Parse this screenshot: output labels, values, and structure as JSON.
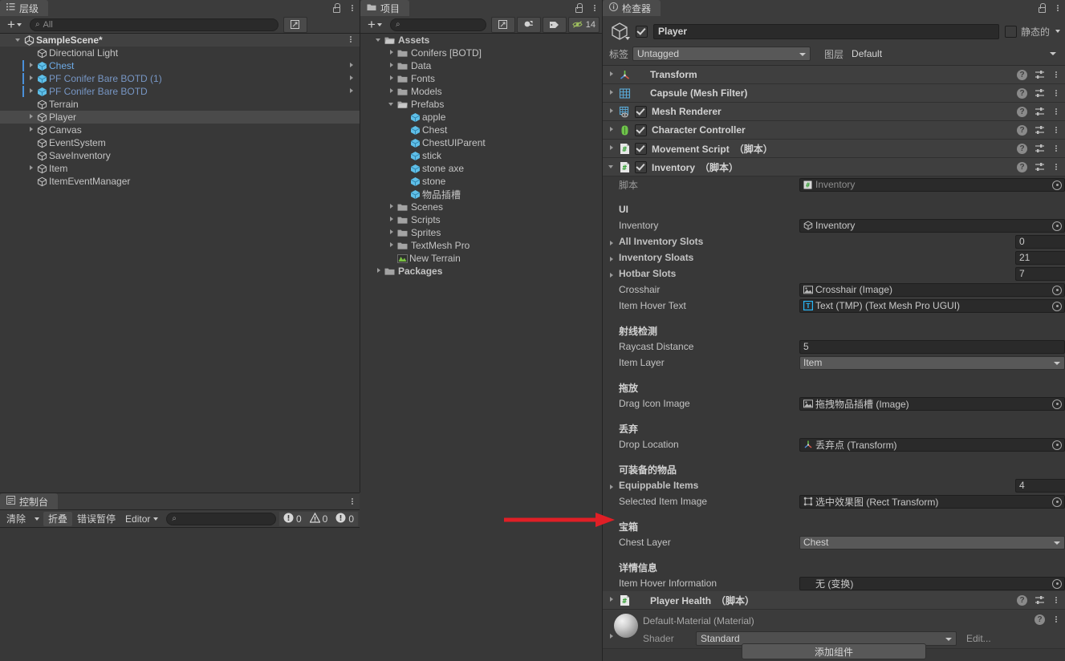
{
  "hierarchy": {
    "tab_label": "层级",
    "tab_icon": "hierarchy-icon",
    "add_label": "+",
    "search_placeholder": "All",
    "items": [
      {
        "name": "SampleScene*",
        "depth": 0,
        "icon": "unity-scene",
        "state": "open",
        "scene": true
      },
      {
        "name": "Directional Light",
        "depth": 1,
        "icon": "gameobject",
        "state": "none"
      },
      {
        "name": "Chest",
        "depth": 1,
        "icon": "prefab",
        "state": "closed",
        "prefab": true,
        "color": "prefab-blue-strong",
        "overflow": true
      },
      {
        "name": "PF Conifer Bare BOTD (1)",
        "depth": 1,
        "icon": "prefab",
        "state": "closed",
        "prefab": true,
        "color": "prefab-blue",
        "overflow": true
      },
      {
        "name": "PF Conifer Bare BOTD",
        "depth": 1,
        "icon": "prefab",
        "state": "closed",
        "prefab": true,
        "color": "prefab-blue",
        "overflow": true
      },
      {
        "name": "Terrain",
        "depth": 1,
        "icon": "gameobject",
        "state": "none"
      },
      {
        "name": "Player",
        "depth": 1,
        "icon": "gameobject",
        "state": "closed",
        "selected": true
      },
      {
        "name": "Canvas",
        "depth": 1,
        "icon": "gameobject",
        "state": "closed"
      },
      {
        "name": "EventSystem",
        "depth": 1,
        "icon": "gameobject",
        "state": "none"
      },
      {
        "name": "SaveInventory",
        "depth": 1,
        "icon": "gameobject",
        "state": "none"
      },
      {
        "name": "Item",
        "depth": 1,
        "icon": "gameobject",
        "state": "closed"
      },
      {
        "name": "ItemEventManager",
        "depth": 1,
        "icon": "gameobject",
        "state": "none"
      }
    ]
  },
  "project": {
    "tab_label": "项目",
    "tab_icon": "folder-icon",
    "add_label": "+",
    "search_placeholder": "",
    "toolbar_buttons": [
      "save-search-icon",
      "packages-icon",
      "label-icon"
    ],
    "hidden_count": "14",
    "items": [
      {
        "name": "Assets",
        "depth": 0,
        "icon": "folder-open",
        "state": "open",
        "bold": true
      },
      {
        "name": "Conifers [BOTD]",
        "depth": 1,
        "icon": "folder",
        "state": "closed"
      },
      {
        "name": "Data",
        "depth": 1,
        "icon": "folder",
        "state": "closed"
      },
      {
        "name": "Fonts",
        "depth": 1,
        "icon": "folder",
        "state": "closed"
      },
      {
        "name": "Models",
        "depth": 1,
        "icon": "folder",
        "state": "closed"
      },
      {
        "name": "Prefabs",
        "depth": 1,
        "icon": "folder-open",
        "state": "open"
      },
      {
        "name": "apple",
        "depth": 2,
        "icon": "prefab",
        "state": "none"
      },
      {
        "name": "Chest",
        "depth": 2,
        "icon": "prefab",
        "state": "none"
      },
      {
        "name": "ChestUIParent",
        "depth": 2,
        "icon": "prefab",
        "state": "none"
      },
      {
        "name": "stick",
        "depth": 2,
        "icon": "prefab",
        "state": "none"
      },
      {
        "name": "stone axe",
        "depth": 2,
        "icon": "prefab",
        "state": "none"
      },
      {
        "name": "stone",
        "depth": 2,
        "icon": "prefab",
        "state": "none"
      },
      {
        "name": "物品插槽",
        "depth": 2,
        "icon": "prefab",
        "state": "none"
      },
      {
        "name": "Scenes",
        "depth": 1,
        "icon": "folder",
        "state": "closed"
      },
      {
        "name": "Scripts",
        "depth": 1,
        "icon": "folder",
        "state": "closed"
      },
      {
        "name": "Sprites",
        "depth": 1,
        "icon": "folder",
        "state": "closed"
      },
      {
        "name": "TextMesh Pro",
        "depth": 1,
        "icon": "folder",
        "state": "closed"
      },
      {
        "name": "New Terrain",
        "depth": 1,
        "icon": "terrain",
        "state": "none"
      },
      {
        "name": "Packages",
        "depth": 0,
        "icon": "folder",
        "state": "closed",
        "bold": true
      }
    ]
  },
  "inspector": {
    "tab_label": "检查器",
    "tab_icon": "info-icon",
    "object_name": "Player",
    "object_enabled": true,
    "static_label": "静态的",
    "static_checked": false,
    "tag_label": "标签",
    "tag_value": "Untagged",
    "layer_label": "图层",
    "layer_value": "Default",
    "components": [
      {
        "title": "Transform",
        "icon": "transform-icon",
        "state": "closed",
        "has_checkbox": false
      },
      {
        "title": "Capsule (Mesh Filter)",
        "icon": "mesh-filter-icon",
        "state": "closed",
        "has_checkbox": false
      },
      {
        "title": "Mesh Renderer",
        "icon": "mesh-renderer-icon",
        "state": "closed",
        "has_checkbox": true,
        "checked": true
      },
      {
        "title": "Character Controller",
        "icon": "character-controller-icon",
        "state": "closed",
        "has_checkbox": true,
        "checked": true
      },
      {
        "title": "Movement Script",
        "suffix": "（脚本）",
        "icon": "script-icon",
        "state": "closed",
        "has_checkbox": true,
        "checked": true
      },
      {
        "title": "Inventory",
        "suffix": "（脚本）",
        "icon": "script-icon",
        "state": "open",
        "has_checkbox": true,
        "checked": true
      }
    ],
    "inventory_rows": [
      {
        "kind": "object",
        "label": "脚本",
        "label_gray": true,
        "value": "Inventory",
        "icon": "script-asset-icon",
        "disabled": true
      },
      {
        "kind": "spacer"
      },
      {
        "kind": "header",
        "label": "UI"
      },
      {
        "kind": "object",
        "label": "Inventory",
        "value": "Inventory",
        "icon": "gameobject-icon"
      },
      {
        "kind": "array",
        "label": "All Inventory Slots",
        "value": "0"
      },
      {
        "kind": "array",
        "label": "Inventory Sloats",
        "value": "21"
      },
      {
        "kind": "array",
        "label": "Hotbar Slots",
        "value": "7"
      },
      {
        "kind": "object",
        "label": "Crosshair",
        "value": "Crosshair (Image)",
        "icon": "image-icon"
      },
      {
        "kind": "object",
        "label": "Item Hover Text",
        "value": "Text (TMP) (Text Mesh Pro UGUI)",
        "icon": "tmp-icon"
      },
      {
        "kind": "spacer"
      },
      {
        "kind": "header",
        "label": "射线检测"
      },
      {
        "kind": "text",
        "label": "Raycast Distance",
        "value": "5"
      },
      {
        "kind": "dropdown",
        "label": "Item Layer",
        "value": "Item"
      },
      {
        "kind": "spacer"
      },
      {
        "kind": "header",
        "label": "拖放"
      },
      {
        "kind": "object",
        "label": "Drag Icon Image",
        "value": "拖拽物品插槽 (Image)",
        "icon": "image-icon"
      },
      {
        "kind": "spacer"
      },
      {
        "kind": "header",
        "label": "丢弃"
      },
      {
        "kind": "object",
        "label": "Drop Location",
        "value": "丢弃点 (Transform)",
        "icon": "transform-icon"
      },
      {
        "kind": "spacer"
      },
      {
        "kind": "header",
        "label": "可装备的物品"
      },
      {
        "kind": "array",
        "label": "Equippable Items",
        "value": "4"
      },
      {
        "kind": "object",
        "label": "Selected Item Image",
        "value": "选中效果图 (Rect Transform)",
        "icon": "rect-transform-icon"
      },
      {
        "kind": "spacer"
      },
      {
        "kind": "header",
        "label": "宝箱"
      },
      {
        "kind": "dropdown",
        "label": "Chest Layer",
        "value": "Chest"
      },
      {
        "kind": "spacer"
      },
      {
        "kind": "header",
        "label": "详情信息"
      },
      {
        "kind": "object",
        "label": "Item Hover Information",
        "value": "无 (变换)",
        "icon": "none-icon"
      }
    ],
    "player_health": {
      "title": "Player Health",
      "suffix": "（脚本）",
      "icon": "script-icon",
      "state": "closed"
    },
    "material": {
      "name": "Default-Material (Material)",
      "shader_label": "Shader",
      "shader_value": "Standard",
      "edit_label": "Edit..."
    },
    "add_component_label": "添加组件"
  },
  "console": {
    "tab_label": "控制台",
    "tab_icon": "console-icon",
    "clear_label": "清除",
    "collapse_label": "折叠",
    "error_pause_label": "错误暂停",
    "editor_label": "Editor",
    "search_placeholder": "",
    "log_count": "0",
    "warn_count": "0",
    "error_count": "0"
  },
  "annotation": {
    "arrow_color": "#e01f26",
    "type": "arrow-right"
  }
}
